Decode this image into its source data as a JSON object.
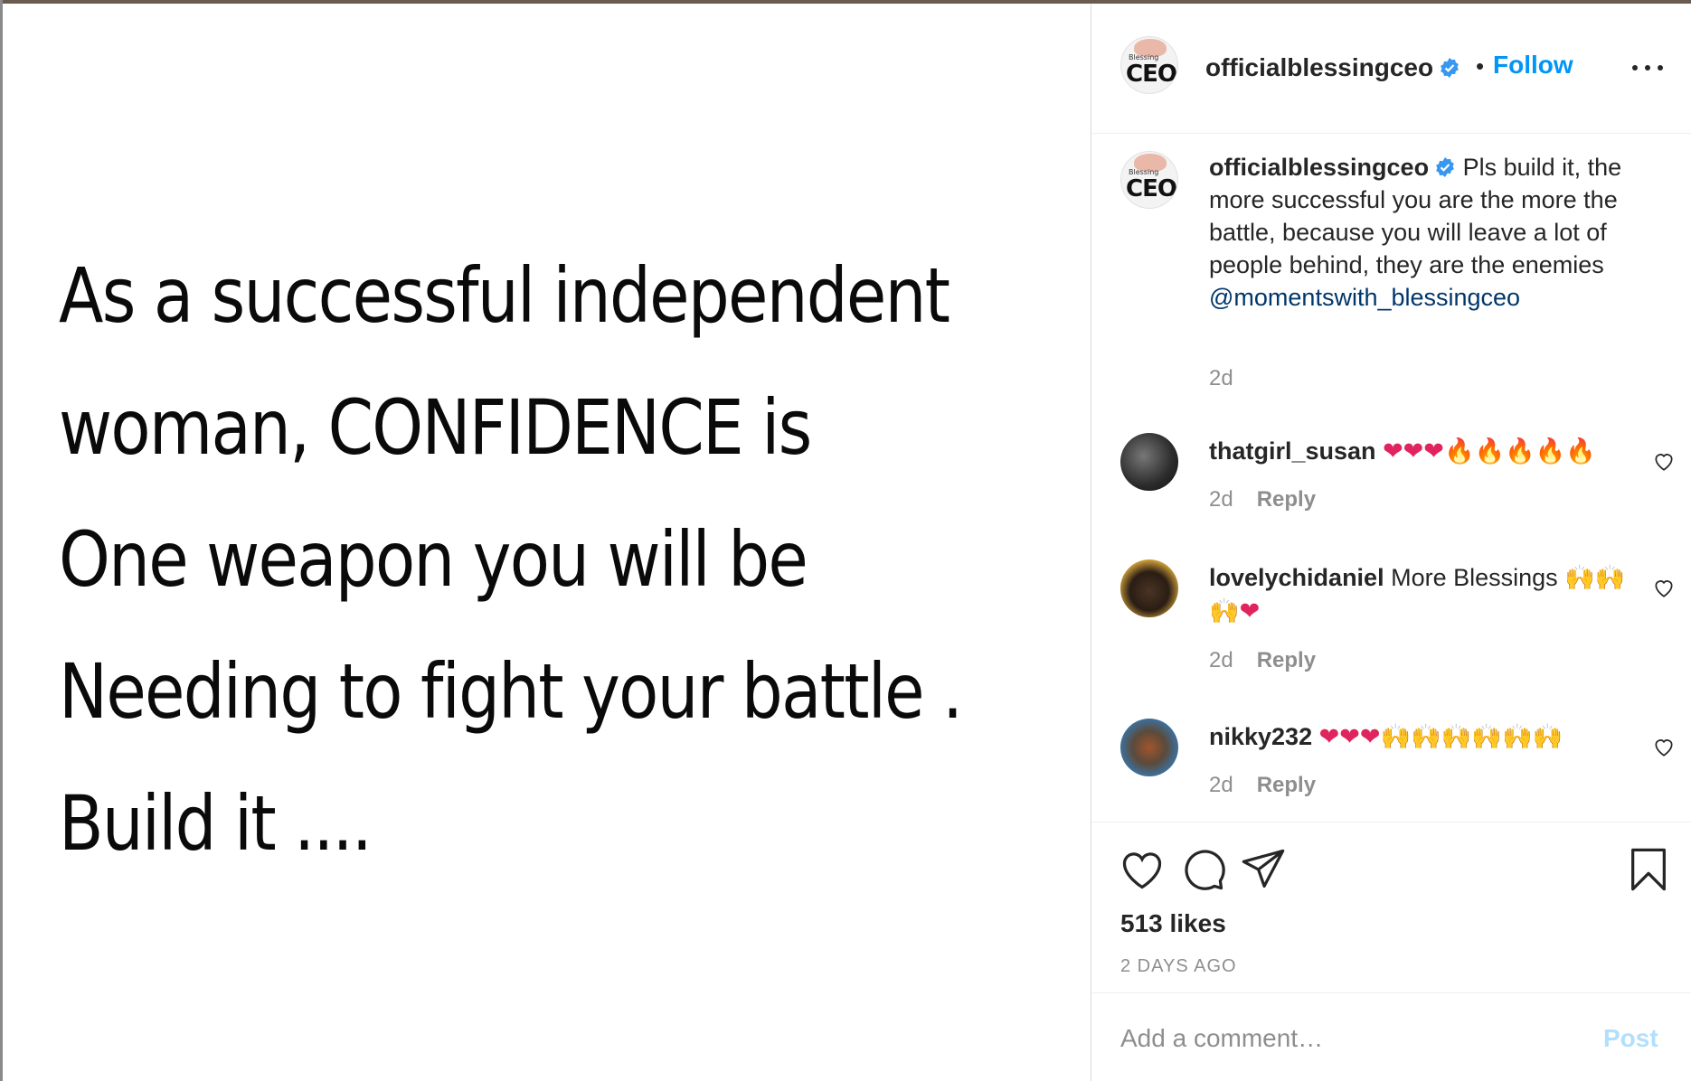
{
  "post": {
    "quote_lines": [
      "As a successful independent",
      "woman, CONFIDENCE is",
      "One weapon you will be",
      "Needing to fight your battle .",
      "Build it ...."
    ]
  },
  "header": {
    "avatar_logo_small": "Blessing",
    "avatar_logo_big": "CEO",
    "username": "officialblessingceo",
    "separator": "•",
    "follow_label": "Follow"
  },
  "caption": {
    "username": "officialblessingceo",
    "text": "Pls build it, the more successful you are the more the battle, because you will leave a lot of people behind, they are the enemies",
    "mention": "@momentswith_blessingceo",
    "time": "2d"
  },
  "comments": [
    {
      "username": "thatgirl_susan",
      "hearts": "❤❤❤",
      "extra": "🔥🔥🔥🔥🔥",
      "time": "2d",
      "reply_label": "Reply"
    },
    {
      "username": "lovelychidaniel",
      "text": "More Blessings",
      "extra": "🙌🙌🙌",
      "hearts": "❤",
      "time": "2d",
      "reply_label": "Reply"
    },
    {
      "username": "nikky232",
      "hearts": "❤❤❤",
      "extra": "🙌🙌🙌🙌🙌🙌",
      "time": "2d",
      "reply_label": "Reply"
    }
  ],
  "actions": {
    "likes": "513 likes",
    "age": "2 DAYS AGO",
    "icons": [
      "heart-icon",
      "comment-icon",
      "share-icon",
      "bookmark-icon"
    ]
  },
  "add_comment": {
    "placeholder": "Add a comment…",
    "post_label": "Post"
  },
  "colors": {
    "accent": "#0095f6",
    "mention": "#00376b",
    "muted": "#8e8e8e",
    "verified": "#3897f0",
    "post_disabled": "#b2dffc"
  }
}
